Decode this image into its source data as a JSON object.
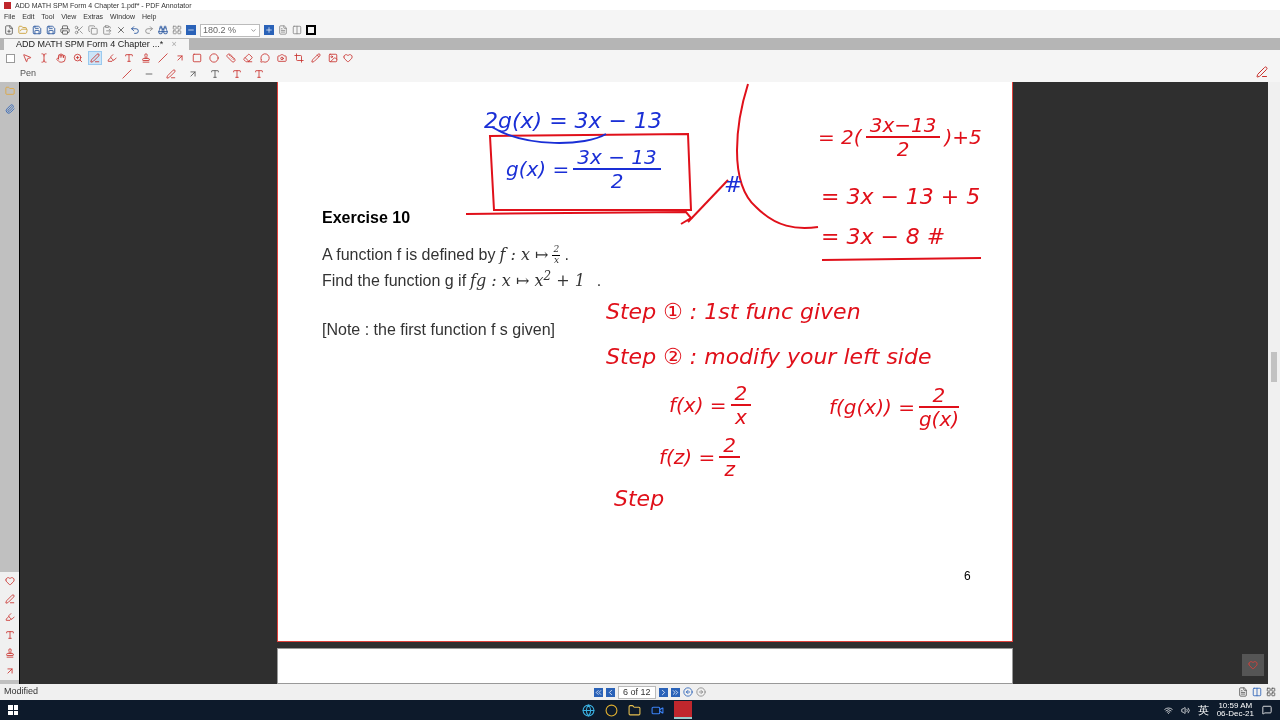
{
  "window": {
    "title": "ADD MATH SPM Form 4 Chapter 1.pdf* - PDF Annotator"
  },
  "menu": [
    "File",
    "Edit",
    "Tool",
    "View",
    "Extras",
    "Window",
    "Help"
  ],
  "zoom": {
    "value": "180.2 %"
  },
  "tab": {
    "label": "ADD MATH SPM Form 4 Chapter ...*",
    "close": "×"
  },
  "panel_checkbox": {
    "checked": false
  },
  "tools": [
    {
      "selected": false
    },
    {
      "selected": false
    },
    {
      "selected": false
    },
    {
      "selected": false
    },
    {
      "selected": true
    },
    {
      "selected": false
    },
    {
      "selected": false
    },
    {
      "selected": false
    },
    {
      "selected": false
    },
    {
      "selected": false
    },
    {
      "selected": false
    },
    {
      "selected": false
    },
    {
      "selected": false
    },
    {
      "selected": false
    },
    {
      "selected": false
    },
    {
      "selected": false
    },
    {
      "selected": false
    },
    {
      "selected": false
    },
    {
      "selected": false
    }
  ],
  "tool_label": "Pen",
  "page": {
    "heading": "Exercise 10",
    "line_1": {
      "text": "A function f is defined by",
      "math": "f : x ↦",
      "num": "2",
      "den": "x",
      "end": "."
    },
    "line_2": {
      "text": "Find the function g if",
      "math": "fg : x ↦ x$^{2}$ + 1",
      "end": "."
    },
    "note": "[Note : the first function f s given]",
    "number": "6"
  },
  "ink": [
    {
      "kind": "line",
      "text": "2g(x) = 3x − 13",
      "color": "#1a2fd6"
    },
    {
      "kind": "fraction",
      "lead": "g(x) =",
      "num": "3x − 13",
      "den": "2",
      "color": "#1a2fd6"
    },
    {
      "kind": "fraction",
      "lead": "= 2(",
      "num": "3x−13",
      "den": "2",
      "trail": ")+5",
      "color": "#e0101a"
    },
    {
      "kind": "line",
      "text": "= 3x − 13 + 5",
      "color": "#e0101a"
    },
    {
      "kind": "line",
      "text": "= 3x − 8 #",
      "color": "#e0101a"
    },
    {
      "kind": "line",
      "text": "#",
      "color": "#1a2fd6"
    },
    {
      "kind": "line",
      "text": "Step ① :  1st func given",
      "color": "#e0101a"
    },
    {
      "kind": "line",
      "text": "Step ② :  modify your left side",
      "color": "#e0101a"
    },
    {
      "kind": "fraction",
      "lead": "f(x) =",
      "num": "2",
      "den": "x",
      "color": "#e0101a"
    },
    {
      "kind": "fraction",
      "lead": "f(g(x)) =",
      "num": "2",
      "den": "g(x)",
      "color": "#e0101a"
    },
    {
      "kind": "fraction",
      "lead": "f(z) =",
      "num": "2",
      "den": "z",
      "color": "#e0101a"
    },
    {
      "kind": "line",
      "text": "Step",
      "color": "#e0101a"
    }
  ],
  "status": {
    "text": "Modified",
    "page": "6 of 12"
  },
  "taskbar": {
    "lang": "英",
    "time": "10:59 AM",
    "date": "06-Dec-21"
  }
}
